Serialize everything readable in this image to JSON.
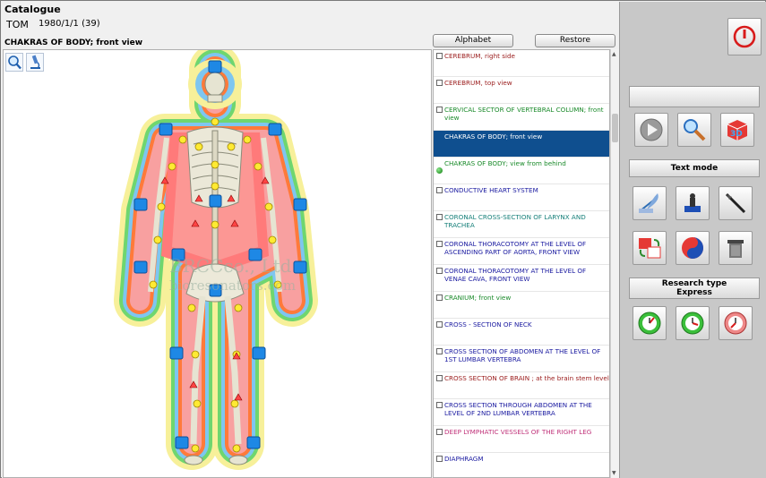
{
  "header": {
    "title": "Catalogue",
    "patient_name": "TOM",
    "patient_date": "1980/1/1 (39)",
    "view_title": "CHAKRAS OF BODY; front view"
  },
  "toolbar": {
    "alphabet_label": "Alphabet",
    "restore_label": "Restore"
  },
  "watermark": {
    "line1": "BRCCco., Ltd",
    "line2": "bioresonators.com"
  },
  "list": {
    "items": [
      {
        "label": "CEREBRUM, right side",
        "color": "#9a1b1b",
        "selected": false
      },
      {
        "label": "CEREBRUM, top view",
        "color": "#9a1b1b",
        "selected": false
      },
      {
        "label": "CERVICAL SECTOR OF VERTEBRAL COLUMN; front view",
        "color": "#1a8a2a",
        "selected": false
      },
      {
        "label": "CHAKRAS OF BODY; front view",
        "color": "#ffffff",
        "selected": true
      },
      {
        "label": "CHAKRAS OF BODY; view from behind",
        "color": "#1a8a2a",
        "selected": false
      },
      {
        "label": "CONDUCTIVE HEART SYSTEM",
        "color": "#1a1aa0",
        "selected": false
      },
      {
        "label": "CORONAL CROSS-SECTION OF LARYNX AND TRACHEA",
        "color": "#17807a",
        "selected": false
      },
      {
        "label": "CORONAL THORACOTOMY AT THE LEVEL OF ASCENDING PART OF AORTA, FRONT VIEW",
        "color": "#1a1aa0",
        "selected": false
      },
      {
        "label": "CORONAL THORACOTOMY AT THE LEVEL OF VENAE CAVA, FRONT VIEW",
        "color": "#1a1aa0",
        "selected": false
      },
      {
        "label": "CRANIUM; front view",
        "color": "#1a8a2a",
        "selected": false
      },
      {
        "label": "CROSS - SECTION OF NECK",
        "color": "#1a1aa0",
        "selected": false
      },
      {
        "label": "CROSS SECTION OF ABDOMEN AT THE LEVEL OF 1ST LUMBAR VERTEBRA",
        "color": "#1a1aa0",
        "selected": false
      },
      {
        "label": "CROSS SECTION OF BRAIN ; at the brain stem level",
        "color": "#9a1b1b",
        "selected": false
      },
      {
        "label": "CROSS SECTION THROUGH ABDOMEN AT THE LEVEL OF 2ND LUMBAR VERTEBRA",
        "color": "#1a1aa0",
        "selected": false
      },
      {
        "label": "DEEP LYMPHATIC VESSELS OF THE RIGHT LEG",
        "color": "#c0337a",
        "selected": false
      },
      {
        "label": "DIAPHRAGM",
        "color": "#1a1aa0",
        "selected": false
      }
    ]
  },
  "right_panel": {
    "text_mode_label": "Text mode",
    "research_type_label": "Research type",
    "research_mode_label": "Express"
  },
  "icons": {
    "power": "power-icon",
    "zoom": "zoom-icon",
    "microscope": "microscope-icon"
  },
  "colors": {
    "selection": "#0f4f8f",
    "power_red": "#d81b1b"
  }
}
